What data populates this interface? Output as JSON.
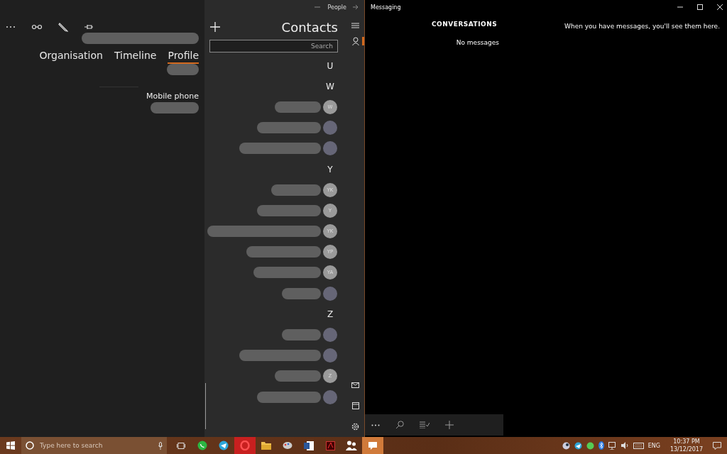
{
  "contact_card": {
    "tabs": [
      {
        "label": "Organisation",
        "selected": false
      },
      {
        "label": "Timeline",
        "selected": false
      },
      {
        "label": "Profile",
        "selected": true
      }
    ],
    "field_label": "Mobile phone"
  },
  "people": {
    "window": {
      "title": "People"
    },
    "heading": "Contacts",
    "search": {
      "placeholder": "Search"
    },
    "list": [
      {
        "kind": "header",
        "letter": "U"
      },
      {
        "kind": "header",
        "letter": "W"
      },
      {
        "kind": "initials",
        "initials": "W"
      },
      {
        "kind": "photo"
      },
      {
        "kind": "photo"
      },
      {
        "kind": "header",
        "letter": "Y"
      },
      {
        "kind": "initials",
        "initials": "YK"
      },
      {
        "kind": "initials",
        "initials": "Y"
      },
      {
        "kind": "initials",
        "initials": "YK"
      },
      {
        "kind": "initials",
        "initials": "YP"
      },
      {
        "kind": "initials",
        "initials": "YA"
      },
      {
        "kind": "photo"
      },
      {
        "kind": "header",
        "letter": "Z"
      },
      {
        "kind": "photo"
      },
      {
        "kind": "photo"
      },
      {
        "kind": "initials",
        "initials": "Z"
      },
      {
        "kind": "photo"
      }
    ]
  },
  "messaging": {
    "window": {
      "title": "Messaging"
    },
    "heading": "CONVERSATIONS",
    "empty_list": "No messages",
    "empty_detail": "When you have messages, you'll see them here."
  },
  "taskbar": {
    "search": {
      "placeholder": "Type here to search"
    },
    "language": "ENG",
    "time": "10:37 PM",
    "date": "13/12/2017"
  }
}
